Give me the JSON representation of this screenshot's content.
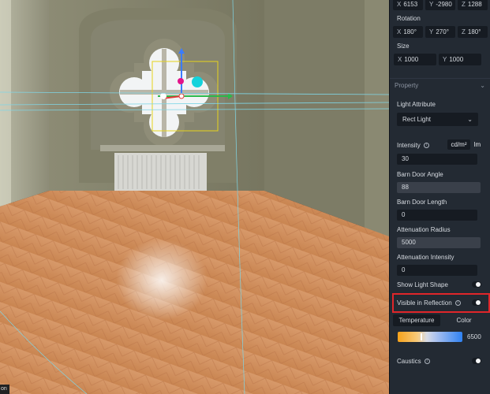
{
  "viewport": {
    "corner_label": "on"
  },
  "transform": {
    "location": {
      "x_axis": "X",
      "x": "6153",
      "y_axis": "Y",
      "y": "-2980",
      "z_axis": "Z",
      "z": "1288"
    },
    "rotation_label": "Rotation",
    "rotation": {
      "x_axis": "X",
      "x": "180°",
      "y_axis": "Y",
      "y": "270°",
      "z_axis": "Z",
      "z": "180°"
    },
    "size_label": "Size",
    "size": {
      "x_axis": "X",
      "x": "1000",
      "y_axis": "Y",
      "y": "1000"
    }
  },
  "property": {
    "section_title": "Property",
    "light_attribute_label": "Light Attribute",
    "light_attribute_value": "Rect Light",
    "intensity_label": "Intensity",
    "intensity_units": [
      "cd/m²",
      "lm"
    ],
    "intensity_value": "30",
    "barn_door_angle_label": "Barn Door Angle",
    "barn_door_angle_value": "88",
    "barn_door_length_label": "Barn Door Length",
    "barn_door_length_value": "0",
    "attenuation_radius_label": "Attenuation Radius",
    "attenuation_radius_value": "5000",
    "attenuation_intensity_label": "Attenuation Intensity",
    "attenuation_intensity_value": "0",
    "show_light_shape_label": "Show Light Shape",
    "visible_in_reflection_label": "Visible in Reflection",
    "color_tabs": [
      "Temperature",
      "Color"
    ],
    "temperature_value": "6500",
    "caustics_label": "Caustics"
  },
  "colors": {
    "panel_bg": "#232a33",
    "input_bg": "#161b22",
    "highlight": "#e0262a",
    "gradient_warm": "#f7a21a",
    "gradient_cool": "#2f82f3"
  }
}
